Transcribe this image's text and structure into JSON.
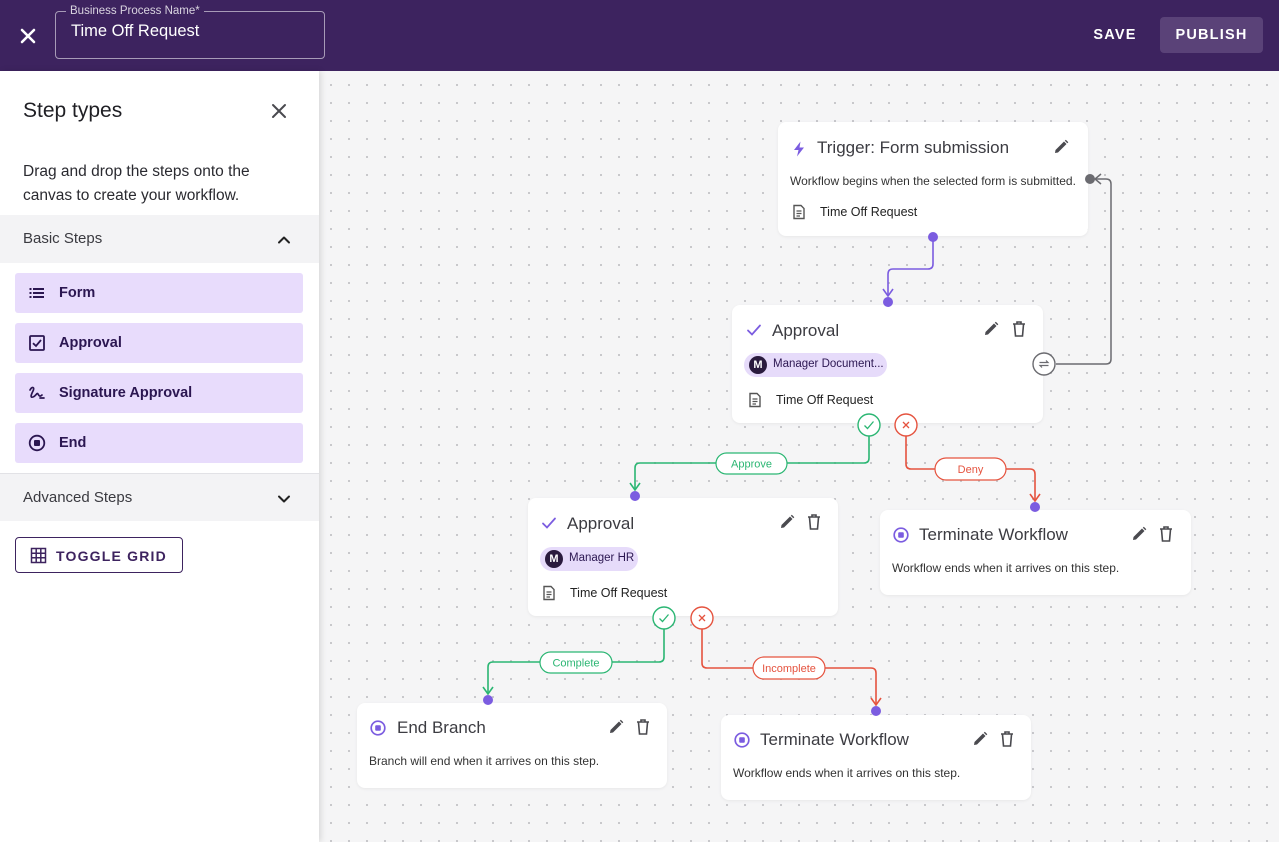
{
  "header": {
    "close_icon": "close-icon",
    "name_field_label": "Business Process Name*",
    "name_field_value": "Time Off Request",
    "save_label": "SAVE",
    "publish_label": "PUBLISH",
    "background_color": "#3d235f"
  },
  "sidebar": {
    "title": "Step types",
    "description": "Drag and drop the steps onto the canvas to create your workflow.",
    "basic_section_label": "Basic Steps",
    "basic_section_expanded": true,
    "basic_steps": [
      {
        "label": "Form",
        "icon": "list-icon"
      },
      {
        "label": "Approval",
        "icon": "checkbox-icon"
      },
      {
        "label": "Signature Approval",
        "icon": "signature-icon"
      },
      {
        "label": "End",
        "icon": "stop-circle-icon"
      }
    ],
    "advanced_section_label": "Advanced Steps",
    "advanced_section_expanded": false,
    "toggle_grid_label": "TOGGLE GRID"
  },
  "canvas": {
    "trigger": {
      "title": "Trigger: Form submission",
      "description": "Workflow begins when the selected form is submitted.",
      "form": "Time Off Request"
    },
    "approval_1": {
      "title": "Approval",
      "assignee_initial": "M",
      "assignee": "Manager Document...",
      "form": "Time Off Request"
    },
    "approval_2": {
      "title": "Approval",
      "assignee_initial": "M",
      "assignee": "Manager HR",
      "form": "Time Off Request"
    },
    "terminate_1": {
      "title": "Terminate Workflow",
      "description": "Workflow ends when it arrives on this step."
    },
    "end_branch": {
      "title": "End Branch",
      "description": "Branch will end when it arrives on this step."
    },
    "terminate_2": {
      "title": "Terminate Workflow",
      "description": "Workflow ends when it arrives on this step."
    },
    "edge_labels": {
      "approve": "Approve",
      "deny": "Deny",
      "complete": "Complete",
      "incomplete": "Incomplete"
    },
    "colors": {
      "accent": "#7b5ce0",
      "approve": "#2bb673",
      "deny": "#e5533f",
      "loop": "#6b6b70"
    }
  }
}
